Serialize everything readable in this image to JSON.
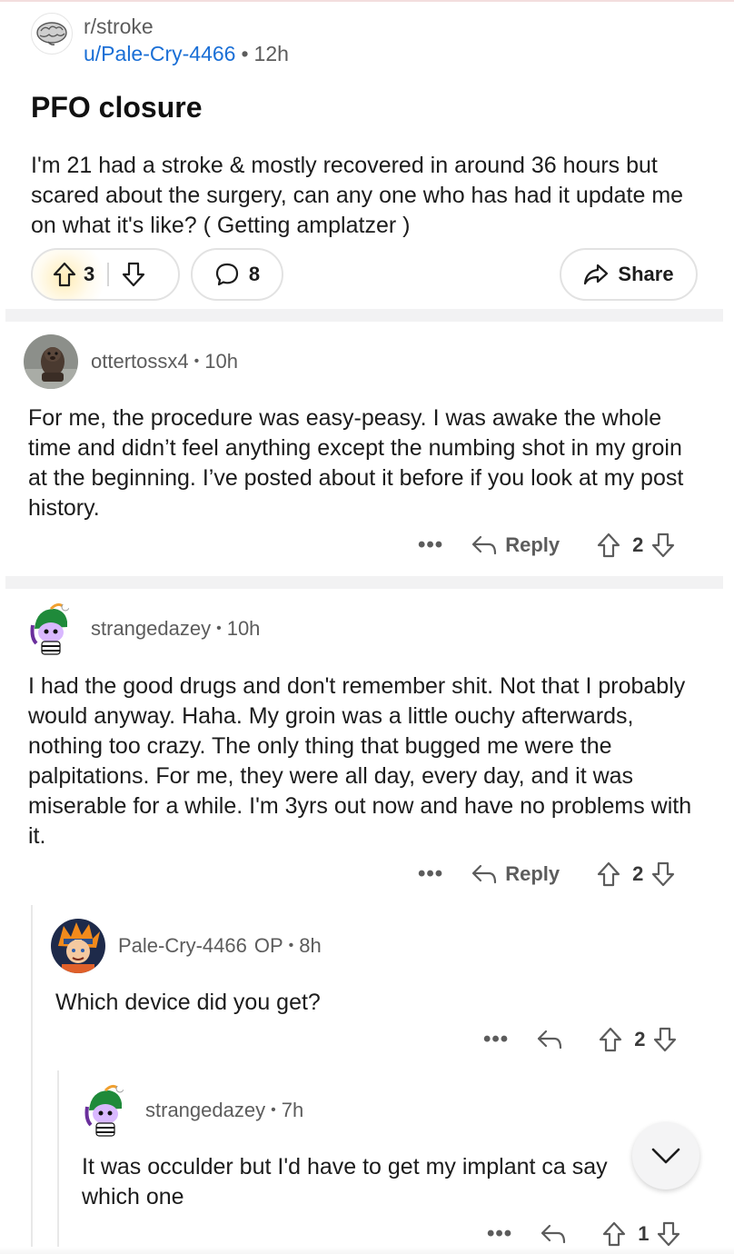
{
  "post": {
    "subreddit": "r/stroke",
    "author": "u/Pale-Cry-4466",
    "time": "12h",
    "title": "PFO closure",
    "body": "I'm 21 had a stroke & mostly recovered in around 36 hours but scared about the surgery, can any one who has had it update me on what it's like? ( Getting amplatzer )",
    "votes": "3",
    "comments": "8",
    "share_label": "Share"
  },
  "comments": [
    {
      "author": "ottertossx4",
      "time": "10h",
      "text": "For me, the procedure was easy-peasy. I was awake the whole time and didn’t feel anything except the numbing shot in my groin at the beginning. I’ve posted about it before if you look at my post history.",
      "reply_label": "Reply",
      "votes": "2"
    },
    {
      "author": "strangedazey",
      "time": "10h",
      "text": "I had the good drugs and don't remember shit. Not that I probably would anyway. Haha. My groin was a little ouchy afterwards, nothing too crazy. The only thing that bugged me were the palpitations. For me, they were all day, every day, and it was miserable for a while. I'm 3yrs out now and have no problems with it.",
      "reply_label": "Reply",
      "votes": "2"
    },
    {
      "author": "Pale-Cry-4466",
      "op_badge": "OP",
      "time": "8h",
      "text": "Which device did you get?",
      "votes": "2"
    },
    {
      "author": "strangedazey",
      "time": "7h",
      "text": "It was occulder but I'd have to get my implant ca say which one",
      "votes": "1"
    }
  ],
  "separator": "•",
  "more_label": "•••",
  "icons": {
    "upvote": "arrow-up-icon",
    "downvote": "arrow-down-icon",
    "comments": "speech-bubble-icon",
    "share": "share-arrow-icon",
    "reply": "reply-arrow-icon",
    "scroll": "chevron-down-icon"
  },
  "colors": {
    "link_blue": "#1a6fd6",
    "meta_gray": "#5c5c5c",
    "divider": "#f2f2f3"
  }
}
